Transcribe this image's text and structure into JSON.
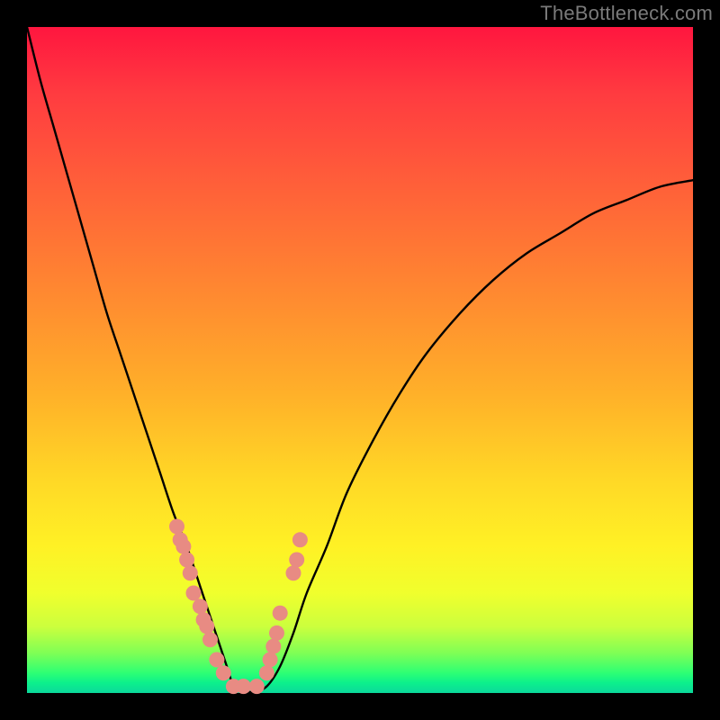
{
  "watermark": "TheBottleneck.com",
  "colors": {
    "curve_stroke": "#000000",
    "dot_fill": "#e88b83",
    "dot_stroke": "#be5f57"
  },
  "chart_data": {
    "type": "line",
    "title": "",
    "xlabel": "",
    "ylabel": "",
    "xlim": [
      0,
      100
    ],
    "ylim": [
      0,
      100
    ],
    "series": [
      {
        "name": "curve",
        "x": [
          0,
          2,
          4,
          6,
          8,
          10,
          12,
          14,
          16,
          18,
          20,
          22,
          24,
          26,
          28,
          30,
          31,
          32,
          34,
          36,
          38,
          40,
          42,
          45,
          48,
          52,
          56,
          60,
          65,
          70,
          75,
          80,
          85,
          90,
          95,
          100
        ],
        "y": [
          100,
          92,
          85,
          78,
          71,
          64,
          57,
          51,
          45,
          39,
          33,
          27,
          22,
          16,
          10,
          4,
          1,
          0.3,
          0.2,
          1,
          4,
          9,
          15,
          22,
          30,
          38,
          45,
          51,
          57,
          62,
          66,
          69,
          72,
          74,
          76,
          77
        ]
      },
      {
        "name": "dots",
        "x": [
          22.5,
          23.0,
          23.5,
          24.0,
          24.5,
          25.0,
          26.0,
          26.5,
          27.0,
          27.5,
          28.5,
          29.5,
          31.0,
          32.5,
          34.5,
          36.0,
          36.5,
          37.0,
          37.5,
          38.0,
          40.0,
          40.5,
          41.0
        ],
        "y": [
          25,
          23,
          22,
          20,
          18,
          15,
          13,
          11,
          10,
          8,
          5,
          3,
          1,
          1,
          1,
          3,
          5,
          7,
          9,
          12,
          18,
          20,
          23
        ]
      }
    ]
  }
}
